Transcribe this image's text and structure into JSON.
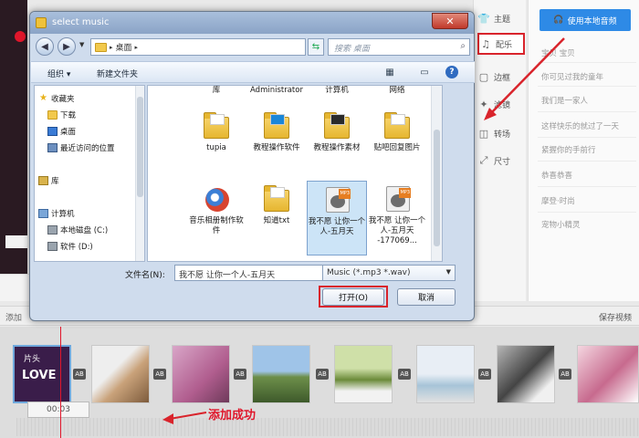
{
  "dialog": {
    "title": "select music",
    "address": "桌面",
    "search_placeholder": "搜索 桌面",
    "toolbar": {
      "organize": "组织",
      "new_folder": "新建文件夹"
    },
    "nav": {
      "favorites": "收藏夹",
      "downloads": "下载",
      "desktop": "桌面",
      "recent": "最近访问的位置",
      "libraries": "库",
      "computer": "计算机",
      "local_disk": "本地磁盘 (C:)",
      "software": "软件 (D:)"
    },
    "columns": [
      "库",
      "Administrator",
      "计算机",
      "网络"
    ],
    "files": [
      {
        "name": "tupia"
      },
      {
        "name": "教程操作软件"
      },
      {
        "name": "教程操作素材"
      },
      {
        "name": "贴吧回复图片"
      },
      {
        "name": "音乐相册制作软件"
      },
      {
        "name": "知道txt"
      },
      {
        "name": "我不愿 让你一个人-五月天",
        "tag": "MP3"
      },
      {
        "name": "我不愿 让你一个人-五月天 -177069...",
        "tag": "MP3"
      }
    ],
    "filename_label": "文件名(N):",
    "filename_value": "我不愿 让你一个人-五月天",
    "filter_value": "Music (*.mp3 *.wav)",
    "open_label": "打开(O)",
    "cancel_label": "取消"
  },
  "tools": [
    {
      "label": "主题",
      "icon": "shirt-icon"
    },
    {
      "label": "配乐",
      "icon": "music-note-icon"
    },
    {
      "label": "边框",
      "icon": "frame-icon"
    },
    {
      "label": "滤镜",
      "icon": "filter-icon"
    },
    {
      "label": "转场",
      "icon": "transition-icon"
    },
    {
      "label": "尺寸",
      "icon": "size-icon"
    }
  ],
  "music_panel": {
    "use_local_label": "使用本地音频",
    "songs": [
      "宝贝 宝贝",
      "你可见过我的童年",
      "我们是一家人",
      "这样快乐的就过了一天",
      "紧握你的手前行",
      "恭喜恭喜",
      "摩登·时尚",
      "宠物小精灵"
    ]
  },
  "timeline": {
    "add_label": "添加",
    "save_label": "保存视频",
    "first_clip_title": "片头",
    "first_clip_sub": "LOVE",
    "clip_time": "00:03",
    "transition_badge": "AB",
    "success_label": "添加成功"
  },
  "colors": {
    "accent_red": "#d9242c",
    "primary_blue": "#2e8ae6"
  }
}
